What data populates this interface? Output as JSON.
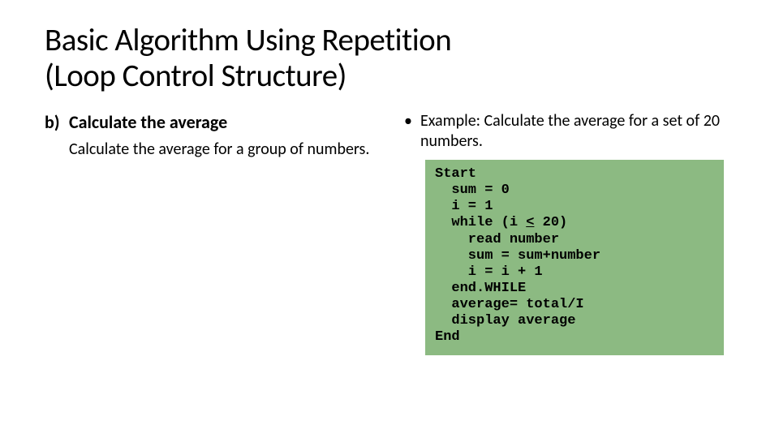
{
  "title_line1": "Basic Algorithm Using Repetition",
  "title_line2": "(Loop Control Structure)",
  "left": {
    "marker": "b)",
    "heading": "Calculate the average",
    "body": "Calculate the average for a group of numbers."
  },
  "right": {
    "bullet": "•",
    "example": "Example: Calculate the average for a set of 20 numbers.",
    "code_l01": "Start",
    "code_l02": "  sum = 0",
    "code_l03": "  i = 1",
    "code_l04a": "  while (i ",
    "code_l04b": "<",
    "code_l04c": " 20)",
    "code_l05": "    read number",
    "code_l06": "    sum = sum+number",
    "code_l07": "    i = i + 1",
    "code_l08": "  end.WHILE",
    "code_l09": "  average= total/I",
    "code_l10": "  display average",
    "code_l11": "End"
  }
}
